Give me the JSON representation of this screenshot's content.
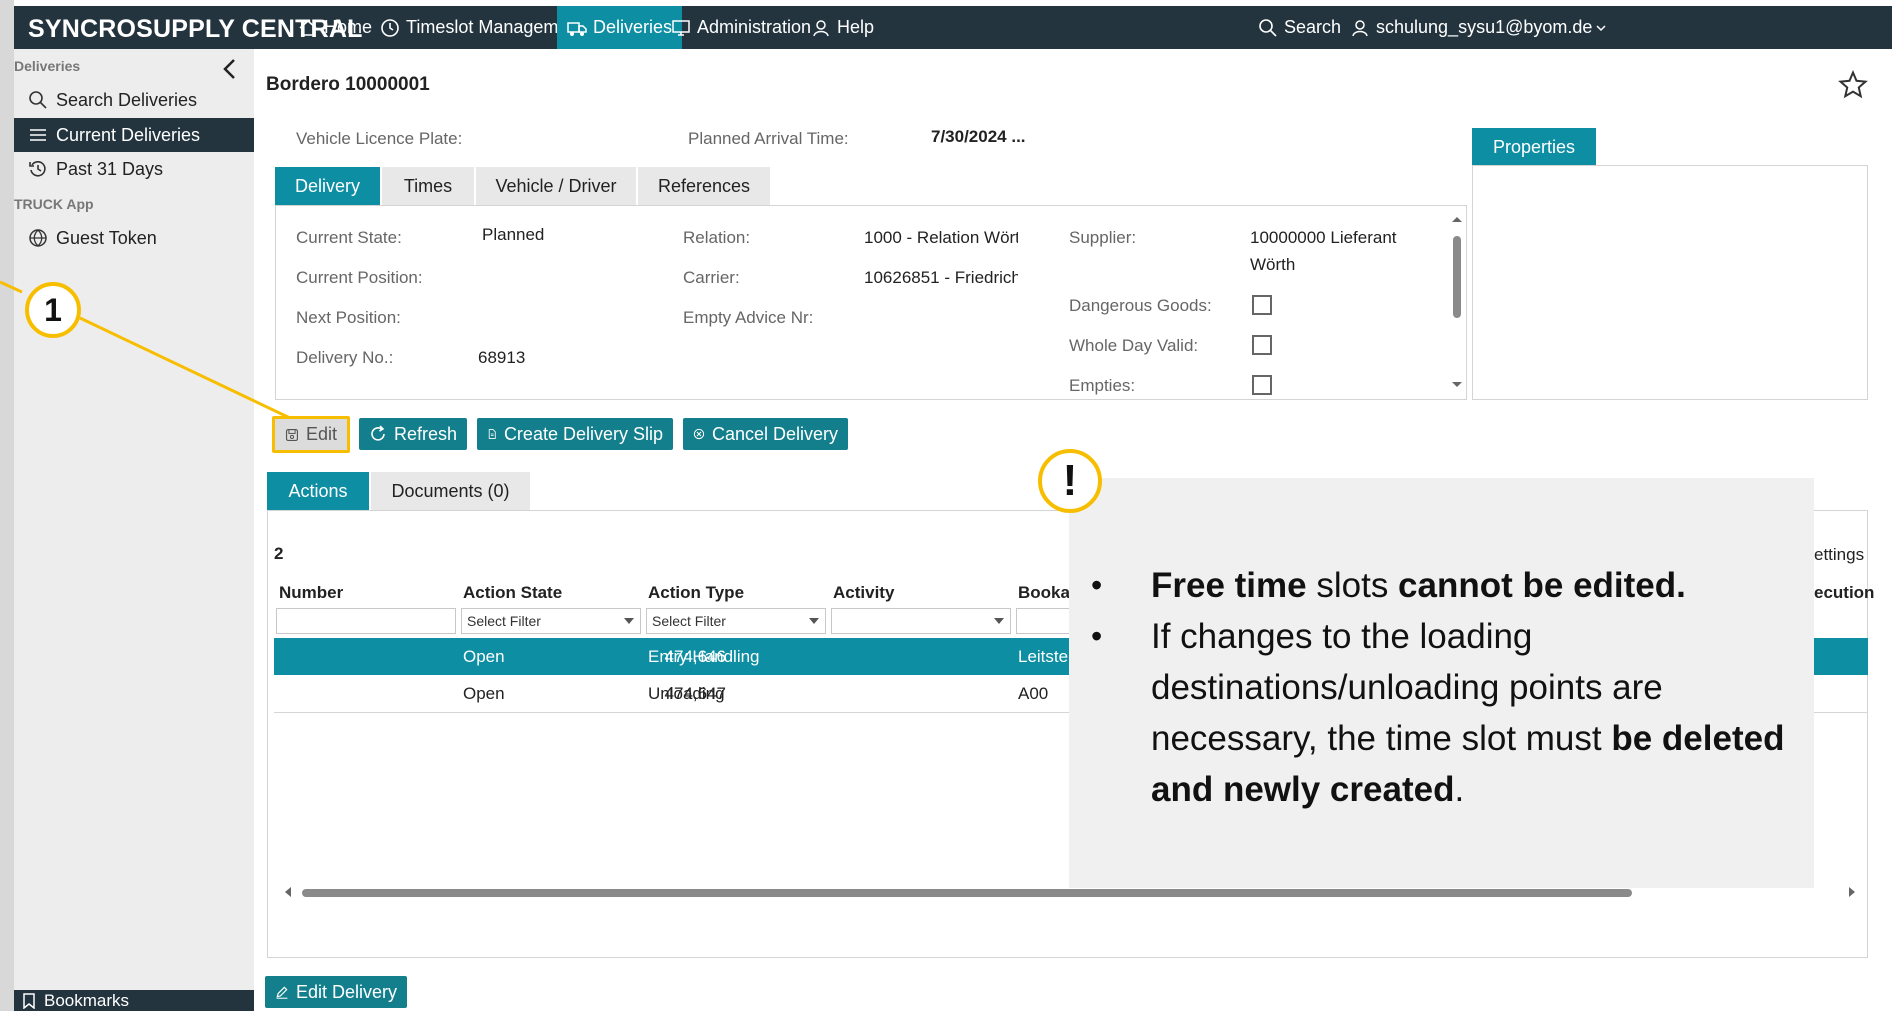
{
  "app": {
    "brand": "SYNCROSUPPLY CENTRAL"
  },
  "nav": {
    "home": "Home",
    "timeslot": "Timeslot Management",
    "deliveries": "Deliveries",
    "administration": "Administration",
    "help": "Help",
    "search": "Search",
    "user": "schulung_sysu1@byom.de"
  },
  "sidebar": {
    "section_deliveries": "Deliveries",
    "search_deliveries": "Search Deliveries",
    "current_deliveries": "Current Deliveries",
    "past_31_days": "Past 31 Days",
    "section_truck": "TRUCK App",
    "guest_token": "Guest Token",
    "bookmarks": "Bookmarks"
  },
  "header": {
    "title": "Bordero 10000001",
    "vehicle_plate_label": "Vehicle Licence Plate:",
    "planned_arrival_label": "Planned Arrival Time:",
    "planned_arrival_value": "7/30/2024 ..."
  },
  "tabs": {
    "delivery": "Delivery",
    "times": "Times",
    "vehicle_driver": "Vehicle / Driver",
    "references": "References",
    "properties": "Properties"
  },
  "delivery": {
    "current_state_label": "Current State:",
    "current_state_value": "Planned",
    "current_position_label": "Current Position:",
    "next_position_label": "Next Position:",
    "delivery_no_label": "Delivery No.:",
    "delivery_no_value": "68913",
    "relation_label": "Relation:",
    "relation_value": "1000 - Relation Wört",
    "carrier_label": "Carrier:",
    "carrier_value": "10626851 - Friedrich",
    "empty_advice_label": "Empty Advice Nr:",
    "supplier_label": "Supplier:",
    "supplier_value_1": "10000000 Lieferant",
    "supplier_value_2": "Wörth",
    "dangerous_goods_label": "Dangerous Goods:",
    "whole_day_label": "Whole Day Valid:",
    "empties_label": "Empties:"
  },
  "buttons": {
    "edit": "Edit",
    "refresh": "Refresh",
    "create_slip": "Create Delivery Slip",
    "cancel_delivery": "Cancel Delivery",
    "edit_delivery": "Edit Delivery"
  },
  "lower_tabs": {
    "actions": "Actions",
    "documents": "Documents (0)"
  },
  "actions_table": {
    "count": "2",
    "settings_fragment": "ettings",
    "columns": [
      "Number",
      "Action State",
      "Action Type",
      "Activity",
      "Bookal",
      "ecution"
    ],
    "filter_placeholder": "Select Filter",
    "rows": [
      {
        "number": "474,646",
        "state": "Open",
        "type": "Entry Handling",
        "booking": "Leitste"
      },
      {
        "number": "474,647",
        "state": "Open",
        "type": "Unloading",
        "booking": "A00"
      }
    ]
  },
  "callout": {
    "b1_part1": "Free time",
    "b1_part2": " slots ",
    "b1_part3": "cannot be edited.",
    "b2_part1": "If changes to the loading destinations/unloading points are necessary, the time slot must ",
    "b2_part2": "be deleted and newly created",
    "b2_part3": "."
  },
  "badges": {
    "step": "1",
    "warning": "!"
  },
  "colors": {
    "topbar": "#23343f",
    "accent": "#0d8ea3",
    "button": "#147f8c",
    "highlight": "#f7be00"
  }
}
